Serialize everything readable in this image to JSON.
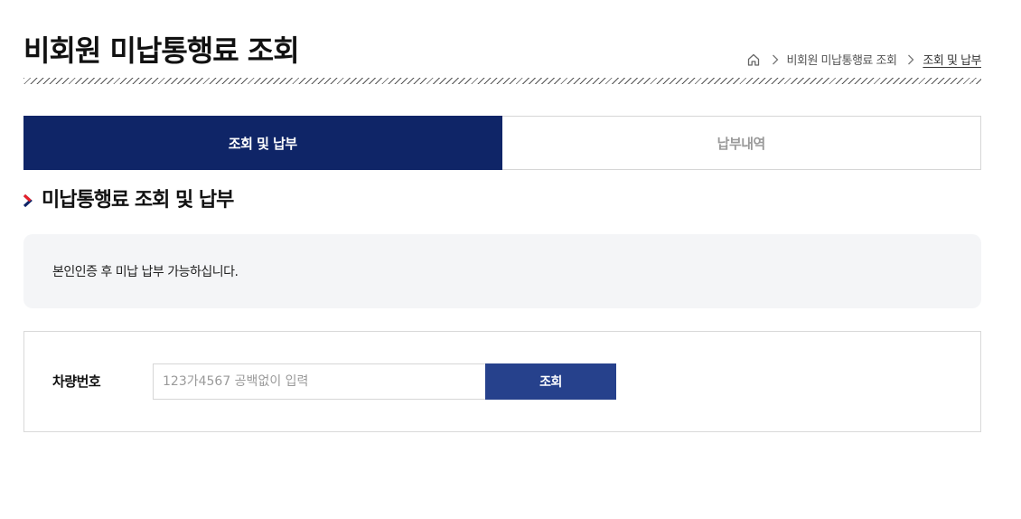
{
  "page": {
    "title": "비회원 미납통행료 조회"
  },
  "breadcrumb": {
    "home_icon": "home-icon",
    "items": [
      "비회원 미납통행료 조회",
      "조회 및 납부"
    ]
  },
  "tabs": [
    {
      "label": "조회 및 납부",
      "active": true
    },
    {
      "label": "납부내역",
      "active": false
    }
  ],
  "section": {
    "title": "미납통행료 조회 및 납부",
    "icon": "chevron-right-icon"
  },
  "notice": {
    "text": "본인인증 후 미납 납부 가능하십니다."
  },
  "form": {
    "plate_label": "차량번호",
    "plate_placeholder": "123가4567 공백없이 입력",
    "plate_value": "",
    "search_label": "조회"
  },
  "colors": {
    "primary_navy": "#0f2567",
    "button_blue": "#26418c",
    "accent_red": "#e8202a",
    "notice_bg": "#f4f5f7"
  }
}
